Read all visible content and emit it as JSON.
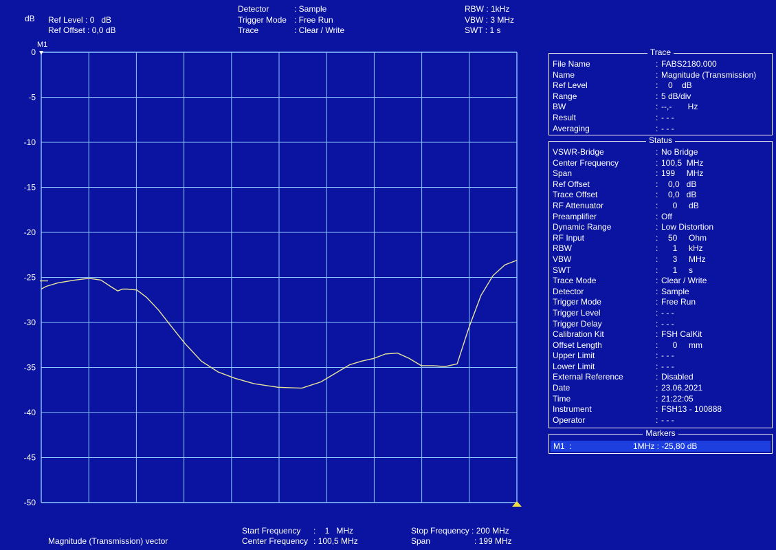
{
  "header": {
    "unit": "dB",
    "ref_level": "Ref Level : 0   dB",
    "ref_offset": "Ref Offset : 0,0 dB",
    "detector_label": "Detector",
    "detector_value": ": Sample",
    "trigger_label": "Trigger Mode",
    "trigger_value": ": Free Run",
    "trace_label": "Trace",
    "trace_value": ": Clear / Write",
    "rbw": "RBW : 1kHz",
    "vbw": "VBW : 3 MHz",
    "swt": "SWT : 1 s"
  },
  "marker_flag": "M1",
  "footer": {
    "mode": "Magnitude (Transmission) vector",
    "start_label": "Start Frequency",
    "start_value": ":    1   MHz",
    "center_label": "Center Frequency",
    "center_value": ": 100,5 MHz",
    "stop": "Stop Frequency : 200 MHz",
    "span_label": "Span",
    "span_value": ": 199 MHz"
  },
  "trace_panel": {
    "title": "Trace",
    "rows": [
      {
        "k": "File Name",
        "v": "FABS2180.000"
      },
      {
        "k": "Name",
        "v": "Magnitude (Transmission)"
      },
      {
        "k": "Ref Level",
        "v": "   0    dB"
      },
      {
        "k": "Range",
        "v": "5 dB/div"
      },
      {
        "k": "BW",
        "v": "--,-       Hz"
      },
      {
        "k": "Result",
        "v": "- - -"
      },
      {
        "k": "Averaging",
        "v": "- - -"
      }
    ]
  },
  "status_panel": {
    "title": "Status",
    "rows": [
      {
        "k": "VSWR-Bridge",
        "v": "No Bridge"
      },
      {
        "k": "Center Frequency",
        "v": "100,5  MHz"
      },
      {
        "k": "Span",
        "v": "199     MHz"
      },
      {
        "k": "Ref Offset",
        "v": "   0,0   dB"
      },
      {
        "k": "Trace Offset",
        "v": "   0,0   dB"
      },
      {
        "k": "RF Attenuator",
        "v": "     0     dB"
      },
      {
        "k": "Preamplifier",
        "v": "Off"
      },
      {
        "k": "Dynamic Range",
        "v": "Low Distortion"
      },
      {
        "k": "RF Input",
        "v": "   50     Ohm"
      },
      {
        "k": "RBW",
        "v": "     1     kHz"
      },
      {
        "k": "VBW",
        "v": "     3     MHz"
      },
      {
        "k": "SWT",
        "v": "     1     s"
      },
      {
        "k": "Trace Mode",
        "v": "Clear / Write"
      },
      {
        "k": "Detector",
        "v": "Sample"
      },
      {
        "k": "Trigger Mode",
        "v": "Free Run"
      },
      {
        "k": "Trigger Level",
        "v": "- - -"
      },
      {
        "k": "Trigger Delay",
        "v": "- - -"
      },
      {
        "k": "Calibration Kit",
        "v": "FSH CalKit"
      },
      {
        "k": "Offset Length",
        "v": "     0     mm"
      },
      {
        "k": "Upper Limit",
        "v": "- - -"
      },
      {
        "k": "Lower Limit",
        "v": "- - -"
      },
      {
        "k": "External Reference",
        "v": "Disabled"
      },
      {
        "k": "Date",
        "v": "23.06.2021"
      },
      {
        "k": "Time",
        "v": "21:22:05"
      },
      {
        "k": "Instrument",
        "v": "FSH13 - 100888"
      },
      {
        "k": "Operator",
        "v": "- - -"
      }
    ]
  },
  "markers_panel": {
    "title": "Markers",
    "m1_name": "M1  :",
    "m1_value": "1MHz : -25,80 dB"
  },
  "colors": {
    "background": "#0a14a0",
    "grid": "#8cc8ff",
    "trace": "#e8e59a",
    "marker_highlight": "#1d3fe0",
    "marker_triangle": "#f0e040"
  },
  "chart_data": {
    "type": "line",
    "ylabel": "dB",
    "ylim": [
      -50,
      0
    ],
    "y_ticks": [
      "0",
      "-5",
      "-10",
      "-15",
      "-20",
      "-25",
      "-30",
      "-35",
      "-40",
      "-45",
      "-50"
    ],
    "xlim": [
      1,
      200
    ],
    "x_unit": "MHz",
    "grid": true,
    "series": [
      {
        "x": [
          1,
          3,
          8,
          15,
          21,
          26,
          30,
          33,
          35,
          37,
          41,
          45,
          50,
          55,
          61,
          68,
          75,
          82,
          90,
          100,
          110,
          118,
          125,
          130,
          135,
          140,
          145,
          150,
          155,
          160,
          165,
          170,
          175,
          180,
          185,
          190,
          195,
          200
        ],
        "y": [
          -26.3,
          -26.0,
          -25.6,
          -25.3,
          -25.1,
          -25.3,
          -26.0,
          -26.5,
          -26.3,
          -26.3,
          -26.4,
          -27.2,
          -28.6,
          -30.3,
          -32.3,
          -34.3,
          -35.5,
          -36.2,
          -36.8,
          -37.2,
          -37.3,
          -36.6,
          -35.5,
          -34.7,
          -34.3,
          -34.0,
          -33.5,
          -33.4,
          -34.0,
          -34.8,
          -34.8,
          -34.9,
          -34.6,
          -30.5,
          -27.0,
          -24.8,
          -23.6,
          -23.1
        ]
      }
    ]
  }
}
